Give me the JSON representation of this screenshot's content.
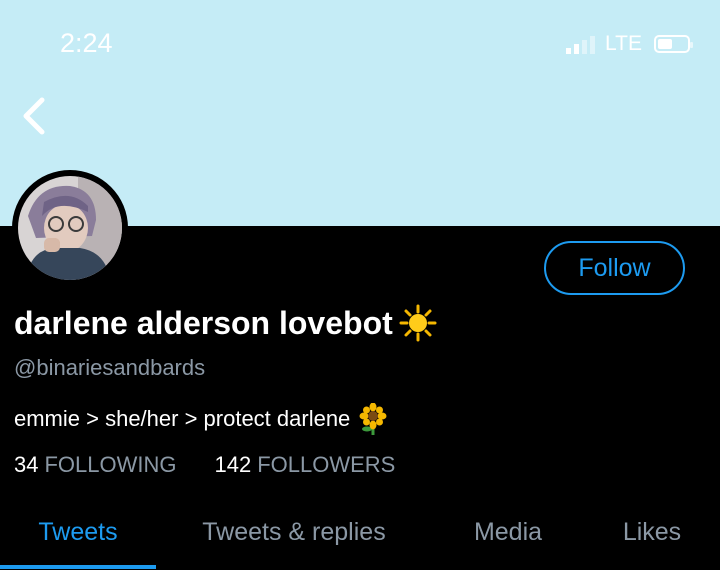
{
  "status_bar": {
    "time": "2:24",
    "network": "LTE"
  },
  "profile": {
    "display_name": "darlene alderson lovebot",
    "handle": "@binariesandbards",
    "bio": "emmie > she/her > protect darlene",
    "following_count": "34",
    "following_label": "FOLLOWING",
    "followers_count": "142",
    "followers_label": "FOLLOWERS",
    "follow_label": "Follow"
  },
  "tabs": [
    {
      "label": "Tweets",
      "active": true
    },
    {
      "label": "Tweets & replies",
      "active": false
    },
    {
      "label": "Media",
      "active": false
    },
    {
      "label": "Likes",
      "active": false
    }
  ],
  "colors": {
    "banner": "#c5ecf6",
    "accent": "#1d9bf0",
    "muted": "#8b98a5",
    "background": "#000000"
  },
  "icons": {
    "back": "chevron-left-icon",
    "name_emoji": "sun-icon",
    "bio_emoji": "sunflower-icon"
  }
}
